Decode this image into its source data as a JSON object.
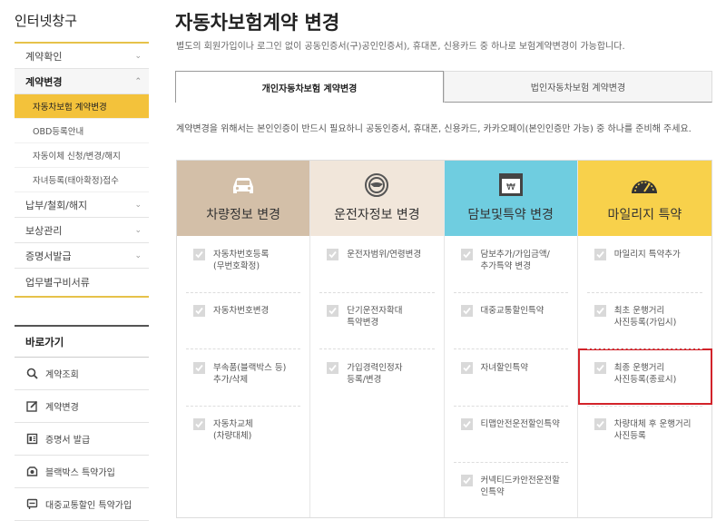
{
  "sidebar": {
    "title": "인터넷창구",
    "menu": [
      {
        "label": "계약확인"
      },
      {
        "label": "계약변경"
      },
      {
        "label": "납부/철회/해지"
      },
      {
        "label": "보상관리"
      },
      {
        "label": "증명서발급"
      },
      {
        "label": "업무별구비서류"
      }
    ],
    "submenu": [
      {
        "label": "자동차보험 계약변경"
      },
      {
        "label": "OBD등록안내"
      },
      {
        "label": "자동이체 신청/변경/해지"
      },
      {
        "label": "자녀등록(태아확정)접수"
      }
    ],
    "quick_title": "바로가기",
    "quick": [
      {
        "label": "계약조회",
        "icon": "search-icon"
      },
      {
        "label": "계약변경",
        "icon": "edit-icon"
      },
      {
        "label": "증명서 발급",
        "icon": "document-icon"
      },
      {
        "label": "블랙박스 특약가입",
        "icon": "camera-icon"
      },
      {
        "label": "대중교통할인 특약가입",
        "icon": "bus-icon"
      }
    ]
  },
  "main": {
    "title": "자동차보험계약 변경",
    "subtitle": "별도의 회원가입이나 로그인 없이 공동인증서(구)공인인증서), 휴대폰, 신용카드 중 하나로 보험계약변경이 가능합니다.",
    "tabs": [
      {
        "label": "개인자동차보험 계약변경"
      },
      {
        "label": "법인자동차보험 계약변경"
      }
    ],
    "notice": "계약변경을 위해서는 본인인증이 반드시 필요하니 공동인증서, 휴대폰, 신용카드, 카카오페이(본인인증만 가능) 중 하나를 준비해 주세요."
  },
  "categories": [
    {
      "title": "차량정보 변경",
      "color": "#d3bfa8",
      "icon": "car-icon",
      "items": [
        "자동차번호등록\n(무번호확정)",
        "자동차번호변경",
        "부속품(블랙박스 등)\n추가/삭제",
        "자동차교체\n(차량대체)"
      ]
    },
    {
      "title": "운전자정보 변경",
      "color": "#f1e6da",
      "icon": "steering-wheel-icon",
      "items": [
        "운전자범위/연령변경",
        "단기운전자확대\n특약변경",
        "가입경력인정자\n등록/변경"
      ]
    },
    {
      "title": "담보및특약 변경",
      "color": "#6fcde0",
      "icon": "money-icon",
      "items": [
        "담보추가/가입금액/\n추가특약 변경",
        "대중교통할인특약",
        "자녀할인특약",
        "티맵안전운전할인특약",
        "커넥티드카안전운전할\n인특약"
      ]
    },
    {
      "title": "마일리지 특약",
      "color": "#f8d14b",
      "icon": "odometer-icon",
      "items": [
        "마일리지 특약추가",
        "최초 운행거리\n사진등록(가입시)",
        "최종 운행거리\n사진등록(종료시)",
        "차량대체 후 운행거리\n사진등록"
      ]
    }
  ]
}
